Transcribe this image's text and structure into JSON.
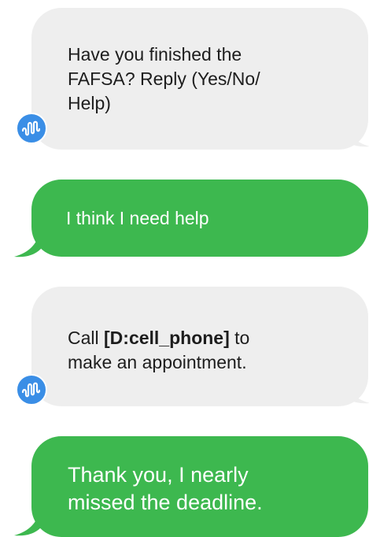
{
  "colors": {
    "bot_bubble": "#eeeeee",
    "user_bubble": "#3db84f",
    "avatar": "#3a8ee6"
  },
  "messages": [
    {
      "sender": "bot",
      "lines": [
        "Have you finished the",
        "FAFSA? Reply (Yes/No/",
        "Help)"
      ],
      "avatar_icon": "sound-wave-icon"
    },
    {
      "sender": "user",
      "text": "I think I need help"
    },
    {
      "sender": "bot",
      "prefix": "Call ",
      "bold": "[D:cell_phone]",
      "suffix": " to",
      "line2": "make an appointment.",
      "avatar_icon": "sound-wave-icon"
    },
    {
      "sender": "user",
      "lines": [
        "Thank you, I nearly",
        "missed the deadline."
      ]
    }
  ]
}
